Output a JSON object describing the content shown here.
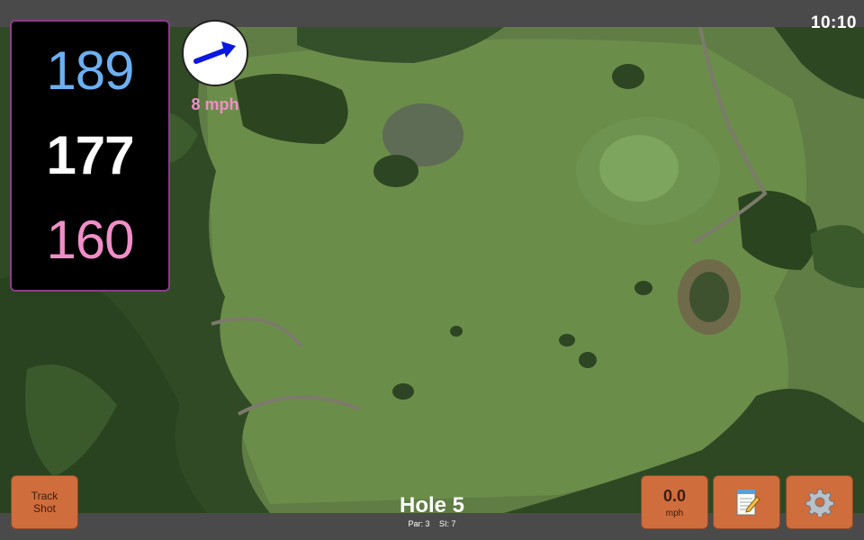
{
  "status_bar": {
    "time": "10:10"
  },
  "distances": {
    "back": "189",
    "middle": "177",
    "front": "160"
  },
  "wind": {
    "speed_label": "8 mph",
    "icon": "wind-arrow-icon"
  },
  "buttons": {
    "track_shot_line1": "Track",
    "track_shot_line2": "Shot",
    "speed_value": "0.0",
    "speed_unit": "mph",
    "notes_icon": "notepad-icon",
    "settings_icon": "gear-icon"
  },
  "hole": {
    "title": "Hole 5",
    "par": "Par: 3",
    "si": "SI: 7"
  },
  "colors": {
    "back_distance": "#6db0f2",
    "front_distance": "#f08ec8",
    "button_fill": "#cf6d3c",
    "panel_border": "#8a3d8a"
  }
}
